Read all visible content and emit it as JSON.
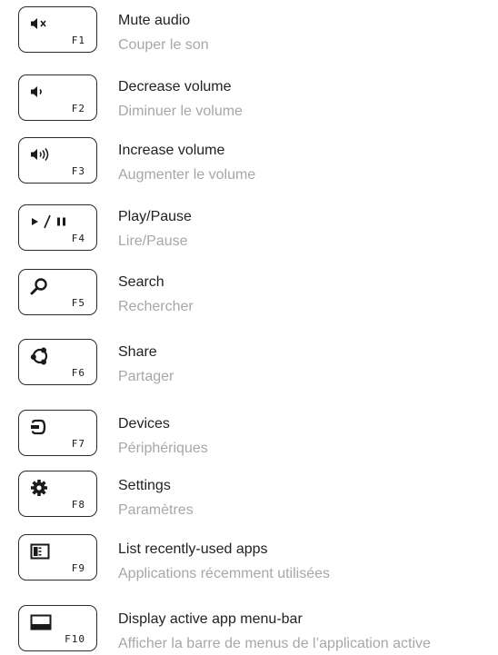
{
  "items": [
    {
      "key": "F1",
      "icon": "mute-icon",
      "label": "Mute audio",
      "label_fr": "Couper le son"
    },
    {
      "key": "F2",
      "icon": "volume-down-icon",
      "label": "Decrease volume",
      "label_fr": "Diminuer le volume"
    },
    {
      "key": "F3",
      "icon": "volume-up-icon",
      "label": "Increase volume",
      "label_fr": "Augmenter le volume"
    },
    {
      "key": "F4",
      "icon": "play-pause-icon",
      "label": "Play/Pause",
      "label_fr": "Lire/Pause"
    },
    {
      "key": "F5",
      "icon": "search-icon",
      "label": "Search",
      "label_fr": "Rechercher"
    },
    {
      "key": "F6",
      "icon": "share-icon",
      "label": "Share",
      "label_fr": "Partager"
    },
    {
      "key": "F7",
      "icon": "devices-icon",
      "label": "Devices",
      "label_fr": "Périphériques"
    },
    {
      "key": "F8",
      "icon": "settings-icon",
      "label": "Settings",
      "label_fr": "Paramètres"
    },
    {
      "key": "F9",
      "icon": "recent-apps-icon",
      "label": "List recently-used apps",
      "label_fr": "Applications récemment utilisées"
    },
    {
      "key": "F10",
      "icon": "app-menu-bar-icon",
      "label": "Display active app menu-bar",
      "label_fr": "Afficher la barre de menus de l’application active"
    }
  ]
}
